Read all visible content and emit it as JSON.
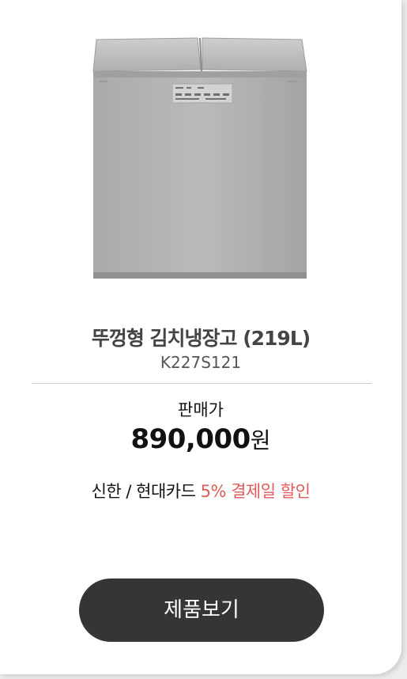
{
  "product": {
    "name": "뚜껑형 김치냉장고 (219L)",
    "model": "K227S121",
    "image_icon": "kimchi-refrigerator-image"
  },
  "pricing": {
    "label": "판매가",
    "amount": "890,000",
    "unit": "원"
  },
  "promotion": {
    "prefix": "신한 / 현대카드 ",
    "highlight": "5% 결제일 할인",
    "highlight_color": "#e05a5a"
  },
  "actions": {
    "view_product_label": "제품보기"
  },
  "colors": {
    "button_bg": "#353535",
    "card_bg": "#ffffff"
  }
}
